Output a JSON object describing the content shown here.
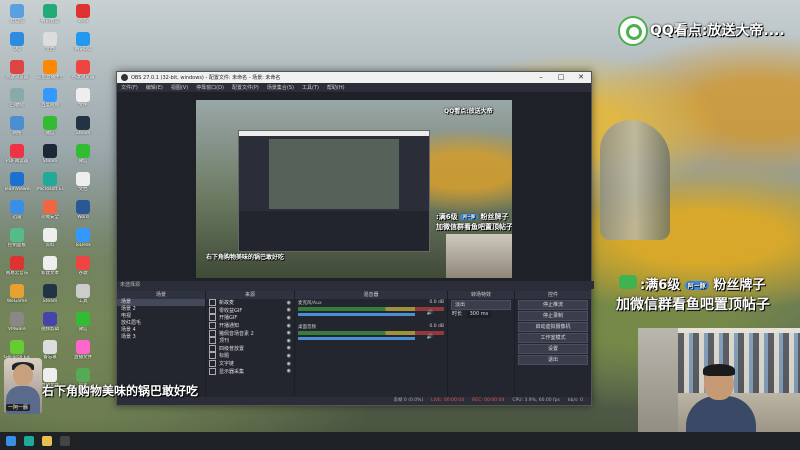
{
  "obs": {
    "title": "OBS 27.0.1 (32-bit, windows) - 配置文件: 未命名 - 场景: 未命名",
    "menu": [
      "文件(F)",
      "编辑(E)",
      "视图(V)",
      "停靠窗口(D)",
      "配置文件(P)",
      "场景集合(S)",
      "工具(T)",
      "帮助(H)"
    ],
    "status_line": "未选择源",
    "docks": {
      "scenes": {
        "title": "场景",
        "items": [
          "场景",
          "场景 2",
          "电视",
          "放红眉毛",
          "场景 4",
          "场景 3"
        ]
      },
      "sources": {
        "title": "来源",
        "items": [
          "新故麦",
          "零收益GIF",
          "开播GIF",
          "开播通知",
          "猪佩音场音素 2",
          "顶刊",
          "四级普放置",
          "标题",
          "文字链",
          "显示器采集"
        ]
      },
      "mixer": {
        "title": "混音器",
        "channels": [
          {
            "name": "麦克风/Aux",
            "level": "0.0 dB"
          },
          {
            "name": "桌面音频",
            "level": "0.0 dB"
          }
        ]
      },
      "transitions": {
        "title": "转场特效",
        "type": "淡出",
        "duration_label": "时长",
        "duration_value": "300 ms"
      },
      "controls": {
        "title": "控件",
        "buttons": [
          "停止推流",
          "停止录制",
          "启动虚拟摄像机",
          "工作室模式",
          "设置",
          "退出"
        ]
      }
    },
    "statusbar": {
      "lost": "丢帧 0 (0.0%)",
      "live": "LIVE: 00:00:04",
      "rec": "REC: 00:00:04",
      "cpu": "CPU: 3.9%, 60.00 fps",
      "kbps": "kb/s: 0"
    }
  },
  "overlays": {
    "top_right": "QQ看点:放送大帝....",
    "right_line1": ":满6级",
    "right_badge": "阿一豚",
    "right_line1b": "粉丝牌子",
    "right_line2": "加微信群看鱼吧置顶帖子",
    "bottom_left": "右下角购物美味的锅巴敢好吃",
    "avatar_tag": "一阿一豚",
    "inner_line1": ":满6级",
    "inner_line1b": "粉丝牌子",
    "inner_line2": "加微信群看鱼吧置顶帖子",
    "inner_bottom": "右下角购物美味的锅巴敢好吃",
    "inner_top": "QQ看点:放送大帝"
  },
  "desktop_icons": [
    {
      "label": "此电脑",
      "color": "#5aa0e0"
    },
    {
      "label": "QQ",
      "color": "#2d8ce0"
    },
    {
      "label": "谷歌浏览器",
      "color": "#d44"
    },
    {
      "label": "回收站",
      "color": "#8aa"
    },
    {
      "label": "网络",
      "color": "#4a90d0"
    },
    {
      "label": "PDF阅读器",
      "color": "#e34"
    },
    {
      "label": "TeamViewer",
      "color": "#1d6fd0"
    },
    {
      "label": "迅雷",
      "color": "#3a8ee6"
    },
    {
      "label": "控制面板",
      "color": "#5b8"
    },
    {
      "label": "网易云音乐",
      "color": "#d33"
    },
    {
      "label": "WeGame",
      "color": "#e8a030"
    },
    {
      "label": "VMware",
      "color": "#888"
    },
    {
      "label": "GeForce Experience",
      "color": "#6c3"
    },
    {
      "label": "OBS",
      "color": "#333"
    },
    {
      "label": "腾讯会议",
      "color": "#2a7"
    },
    {
      "label": "文档",
      "color": "#ddd"
    },
    {
      "label": "斗鱼直播伴侣",
      "color": "#f80"
    },
    {
      "label": "百度网盘",
      "color": "#39f"
    },
    {
      "label": "微信",
      "color": "#3b3"
    },
    {
      "label": "Steam",
      "color": "#1b2838"
    },
    {
      "label": "Microsoft Edge",
      "color": "#2a9"
    },
    {
      "label": "火绒安全",
      "color": "#e64"
    },
    {
      "label": "资料",
      "color": "#eee"
    },
    {
      "label": "新建文本",
      "color": "#eee"
    },
    {
      "label": "Steam",
      "color": "#234"
    },
    {
      "label": "视频剪辑",
      "color": "#44a"
    },
    {
      "label": "备忘录",
      "color": "#ddd"
    },
    {
      "label": "直播文件",
      "color": "#eee"
    },
    {
      "label": "WPS",
      "color": "#d33"
    },
    {
      "label": "腾讯QQ",
      "color": "#29e"
    },
    {
      "label": "谷歌浏览器",
      "color": "#e44"
    },
    {
      "label": "文件",
      "color": "#eee"
    },
    {
      "label": "Steam",
      "color": "#234"
    },
    {
      "label": "微信",
      "color": "#3b3"
    },
    {
      "label": "文档",
      "color": "#eee"
    },
    {
      "label": "Word",
      "color": "#2b5797"
    },
    {
      "label": "ToDesk",
      "color": "#39f"
    },
    {
      "label": "谷歌",
      "color": "#e44"
    },
    {
      "label": "工具",
      "color": "#ccc"
    },
    {
      "label": "微信",
      "color": "#3b3"
    },
    {
      "label": "直播文件",
      "color": "#f6c"
    },
    {
      "label": "风景",
      "color": "#5a5"
    }
  ],
  "taskbar": [
    {
      "name": "start",
      "color": "#3b8ee5"
    },
    {
      "name": "edge",
      "color": "#2a9"
    },
    {
      "name": "file-explorer",
      "color": "#e8c050"
    },
    {
      "name": "obs",
      "color": "#444"
    }
  ]
}
